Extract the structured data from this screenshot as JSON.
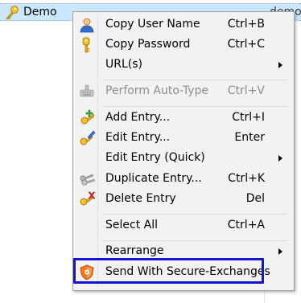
{
  "list": {
    "selected_entry_title": "Demo",
    "selected_entry_user": "demo"
  },
  "menu": {
    "items": [
      {
        "label": "Copy User Name",
        "shortcut": "Ctrl+B",
        "icon": "user-icon",
        "enabled": true
      },
      {
        "label": "Copy Password",
        "shortcut": "Ctrl+C",
        "icon": "key-icon",
        "enabled": true
      },
      {
        "label": "URL(s)",
        "shortcut": "",
        "icon": "",
        "enabled": true,
        "submenu": true
      },
      {
        "label": "Perform Auto-Type",
        "shortcut": "Ctrl+V",
        "icon": "keyboard-icon",
        "enabled": false
      },
      {
        "label": "Add Entry...",
        "shortcut": "Ctrl+I",
        "icon": "key-add-icon",
        "enabled": true
      },
      {
        "label": "Edit Entry...",
        "shortcut": "Enter",
        "icon": "key-edit-icon",
        "enabled": true
      },
      {
        "label": "Edit Entry (Quick)",
        "shortcut": "",
        "icon": "",
        "enabled": true,
        "submenu": true
      },
      {
        "label": "Duplicate Entry...",
        "shortcut": "Ctrl+K",
        "icon": "key-duplicate-icon",
        "enabled": true
      },
      {
        "label": "Delete Entry",
        "shortcut": "Del",
        "icon": "key-delete-icon",
        "enabled": true
      },
      {
        "label": "Select All",
        "shortcut": "Ctrl+A",
        "icon": "",
        "enabled": true
      },
      {
        "label": "Rearrange",
        "shortcut": "",
        "icon": "",
        "enabled": true,
        "submenu": true
      },
      {
        "label": "Send With Secure-Exchanges",
        "shortcut": "",
        "icon": "shield-icon",
        "enabled": true,
        "highlighted": true
      }
    ]
  },
  "colors": {
    "selection_bg": "#cce8ff",
    "menu_bg": "#f2f2f2",
    "highlight_border": "#1414d9",
    "disabled_text": "#8d8d8d"
  }
}
